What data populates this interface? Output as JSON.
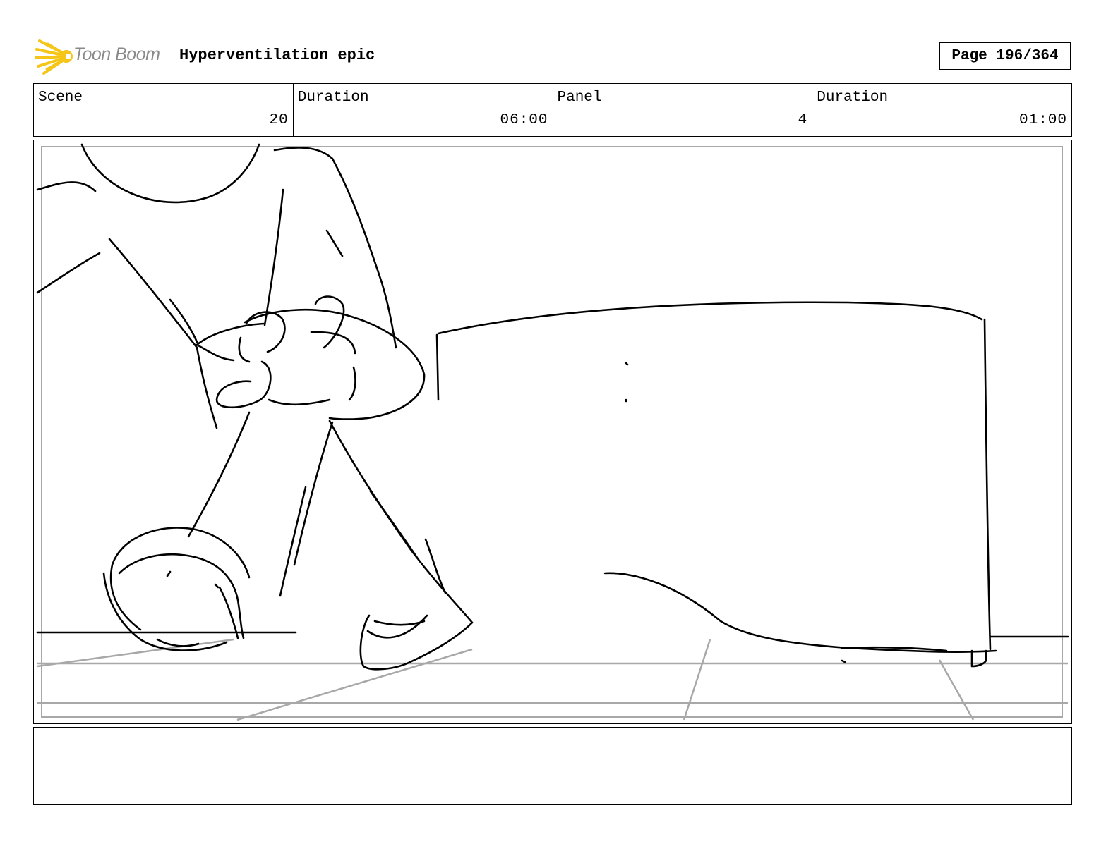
{
  "header": {
    "logo_text": "Toon Boom",
    "project_title": "Hyperventilation epic",
    "page_label": "Page 196/364"
  },
  "info": {
    "scene_label": "Scene",
    "scene_value": "20",
    "scene_duration_label": "Duration",
    "scene_duration_value": "06:00",
    "panel_label": "Panel",
    "panel_value": "4",
    "panel_duration_label": "Duration",
    "panel_duration_value": "01:00"
  },
  "colors": {
    "logo_star": "#f5c518",
    "logo_text": "#8a8a8a",
    "sketch_line": "#000000",
    "guide_line": "#a8a8a8"
  },
  "notes": {
    "text": ""
  }
}
